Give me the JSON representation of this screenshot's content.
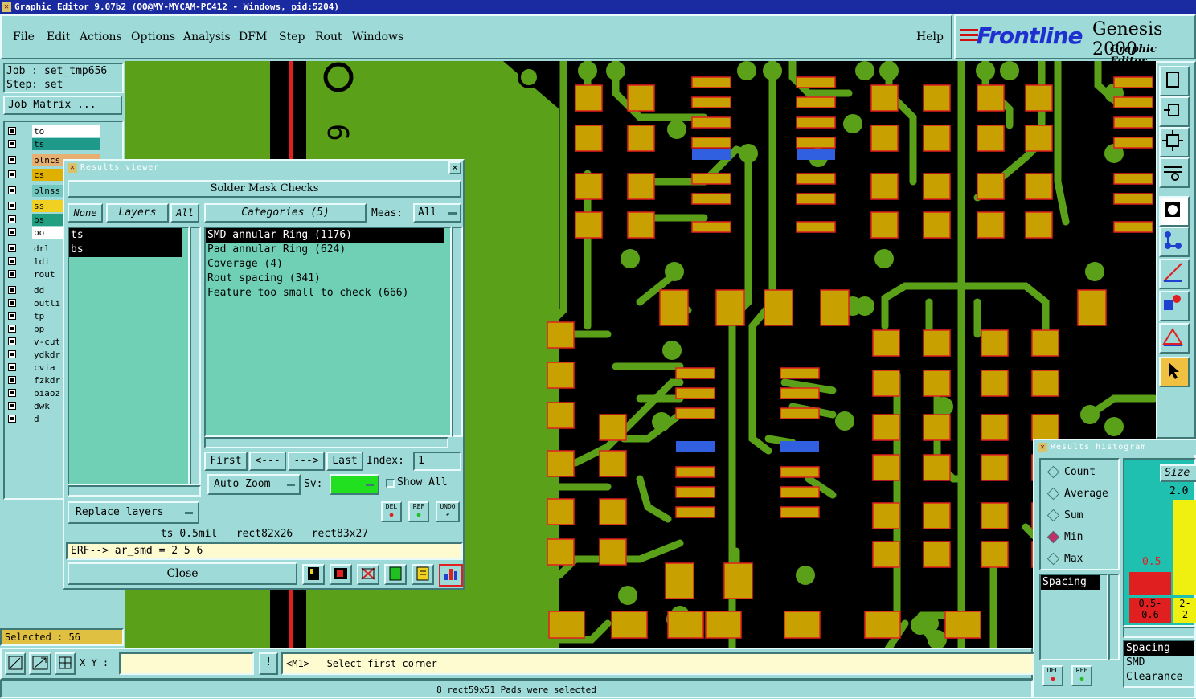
{
  "window": {
    "title": "Graphic Editor 9.07b2 (OO@MY-MYCAM-PC412 - Windows, pid:5204)"
  },
  "menu": {
    "items": [
      "File",
      "Edit",
      "Actions",
      "Options",
      "Analysis",
      "DFM",
      "Step",
      "Rout",
      "Windows"
    ],
    "help": "Help"
  },
  "logo": {
    "brand": "Frontline",
    "product": "Genesis 2000",
    "subtitle": "Graphic Editor"
  },
  "job": {
    "job_label": "Job : set_tmp656",
    "step_label": "Step: set",
    "matrix_button": "Job Matrix ..."
  },
  "layers": [
    {
      "name": "to",
      "color": "#ffffff"
    },
    {
      "name": "ts",
      "color": "#1f9a8a"
    },
    {
      "name": "plncs",
      "color": "#e8b070"
    },
    {
      "name": "cs",
      "color": "#e0b000"
    },
    {
      "name": "plnss",
      "color": "#70c8c0"
    },
    {
      "name": "ss",
      "color": "#f0d020"
    },
    {
      "name": "bs",
      "color": "#20a080"
    },
    {
      "name": "bo",
      "color": "#ffffff"
    },
    {
      "name": "drl",
      "color": "#9edbd8"
    },
    {
      "name": "ldi",
      "color": "#9edbd8"
    },
    {
      "name": "rout",
      "color": "#9edbd8"
    },
    {
      "name": "dd",
      "color": "#9edbd8"
    },
    {
      "name": "outli",
      "color": "#9edbd8"
    },
    {
      "name": "tp",
      "color": "#9edbd8"
    },
    {
      "name": "bp",
      "color": "#9edbd8"
    },
    {
      "name": "v-cut",
      "color": "#9edbd8"
    },
    {
      "name": "ydkdr",
      "color": "#9edbd8"
    },
    {
      "name": "cvia",
      "color": "#9edbd8"
    },
    {
      "name": "fzkdr",
      "color": "#9edbd8"
    },
    {
      "name": "biaoz",
      "color": "#9edbd8"
    },
    {
      "name": "dwk",
      "color": "#9edbd8"
    },
    {
      "name": "d",
      "color": "#9edbd8"
    }
  ],
  "selected": "Selected : 56",
  "results_viewer": {
    "title": "Results viewer",
    "header": "Solder Mask Checks",
    "none_btn": "None",
    "layers_btn": "Layers",
    "all_btn": "All",
    "categories_btn": "Categories (5)",
    "meas_label": "Meas:",
    "meas_value": "All",
    "layer_list": [
      "ts",
      "bs"
    ],
    "category_list": [
      "SMD annular Ring (1176)",
      "Pad annular Ring (624)",
      "Coverage (4)",
      "Rout spacing (341)",
      "Feature too small to check (666)"
    ],
    "nav": {
      "first": "First",
      "prev": "<---",
      "next": "--->",
      "last": "Last",
      "index_label": "Index:",
      "index_value": "1"
    },
    "auto_zoom": "Auto Zoom",
    "sv_label": "Sv:",
    "show_all": "Show All",
    "replace_layers": "Replace layers",
    "icon_del": "DEL",
    "icon_ref": "REF",
    "icon_undo": "UNDO",
    "info_line": "ts 0.5mil   rect82x26   rect83x27",
    "erf_line": "ERF--> ar_smd = 2 5 6",
    "close": "Close"
  },
  "histogram": {
    "title": "Results histogram",
    "options": [
      "Count",
      "Average",
      "Sum",
      "Min",
      "Max"
    ],
    "selected_option": "Min",
    "list": [
      "Spacing"
    ],
    "size_label": "Size",
    "top_value": "2.0",
    "bar_label": "0.5",
    "bin_1": "0.5-\n0.6",
    "bin_2": "2-\n2",
    "measures": [
      "Spacing",
      "SMD",
      "Clearance"
    ],
    "del": "DEL",
    "ref": "REF"
  },
  "bottom": {
    "xy_label": "X Y :",
    "prompt": "<M1> - Select first corner",
    "status": "8 rect59x51 Pads were selected"
  },
  "colors": {
    "board_bg": "#000000",
    "copper": "#5aa018",
    "pad": "#c8a000",
    "pad_outline": "#e02020",
    "highlight": "#3060e0"
  }
}
